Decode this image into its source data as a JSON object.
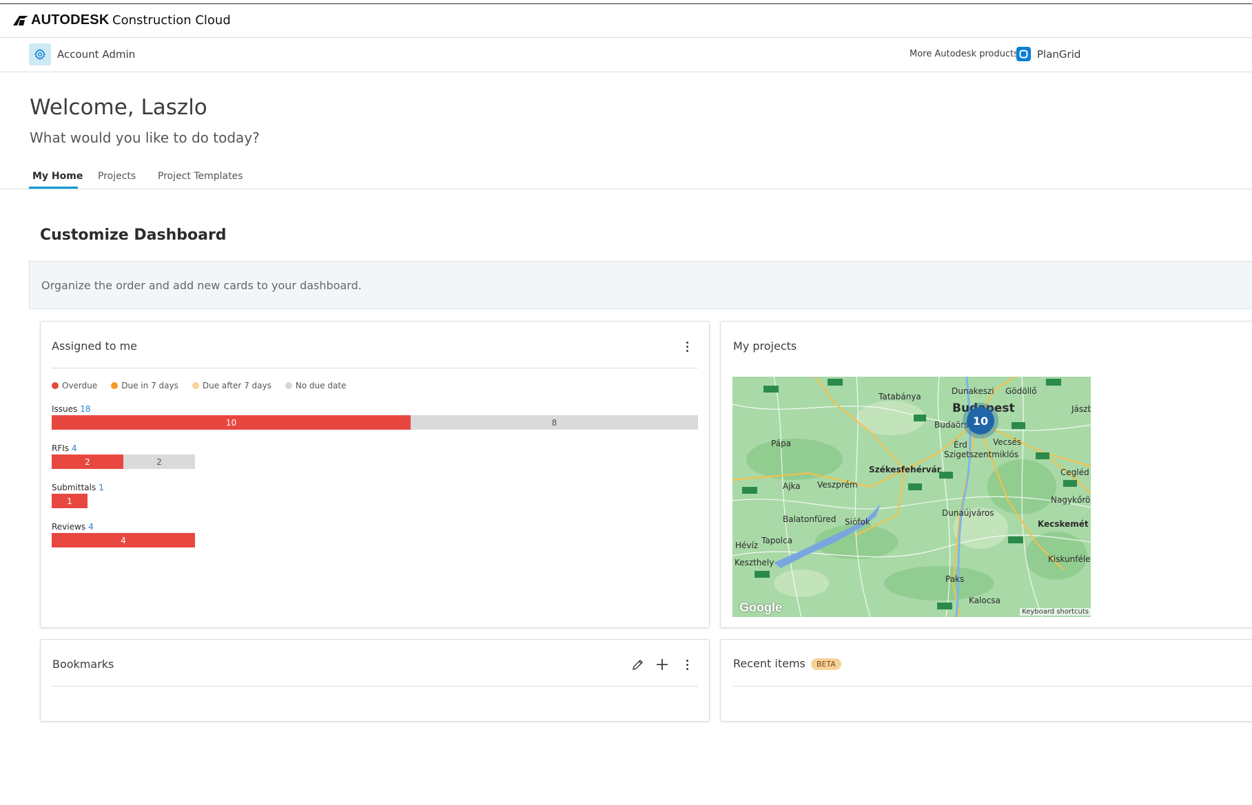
{
  "brand": {
    "name": "AUTODESK",
    "product": "Construction Cloud"
  },
  "appbar": {
    "admin_label": "Account Admin",
    "more_products": "More Autodesk products",
    "plangrid_label": "PlanGrid"
  },
  "welcome": {
    "title": "Welcome, Laszlo",
    "subtitle": "What would you like to do today?"
  },
  "tabs": [
    {
      "label": "My Home",
      "active": true
    },
    {
      "label": "Projects",
      "active": false
    },
    {
      "label": "Project Templates",
      "active": false
    }
  ],
  "dashboard": {
    "title": "Customize Dashboard",
    "info": "Organize the order and add new cards to your dashboard."
  },
  "assigned": {
    "title": "Assigned to me",
    "legend": [
      {
        "label": "Overdue",
        "color": "#e8473f"
      },
      {
        "label": "Due in 7 days",
        "color": "#f59a23"
      },
      {
        "label": "Due after 7 days",
        "color": "#f7d29a"
      },
      {
        "label": "No due date",
        "color": "#d6d6d6"
      }
    ],
    "rows": [
      {
        "label": "Issues",
        "total": "18",
        "overdue": "10",
        "no_due": "8"
      },
      {
        "label": "RFIs",
        "total": "4",
        "overdue": "2",
        "no_due": "2"
      },
      {
        "label": "Submittals",
        "total": "1",
        "overdue": "1"
      },
      {
        "label": "Reviews",
        "total": "4",
        "overdue": "4"
      }
    ]
  },
  "my_projects": {
    "title": "My projects",
    "cluster_count": "10",
    "places": [
      "Tatabánya",
      "Dunakeszi",
      "Gödöllő",
      "Budapest",
      "Budaörs",
      "Pápa",
      "Érd",
      "Vecsés",
      "Szigetszentmiklós",
      "Székesfehérvár",
      "Ajka",
      "Veszprém",
      "Cegléd",
      "Nagykőrös",
      "Dunaújváros",
      "Balatonfüred",
      "Siófok",
      "Kecskemét",
      "Tapolca",
      "Hévíz",
      "Keszthely",
      "Kiskunfélegyháza",
      "Paks",
      "Kalocsa",
      "Jászberény"
    ],
    "attribution": "Google",
    "footer": "Keyboard shortcuts"
  },
  "bookmarks": {
    "title": "Bookmarks"
  },
  "recent": {
    "title": "Recent items",
    "badge": "BETA"
  }
}
